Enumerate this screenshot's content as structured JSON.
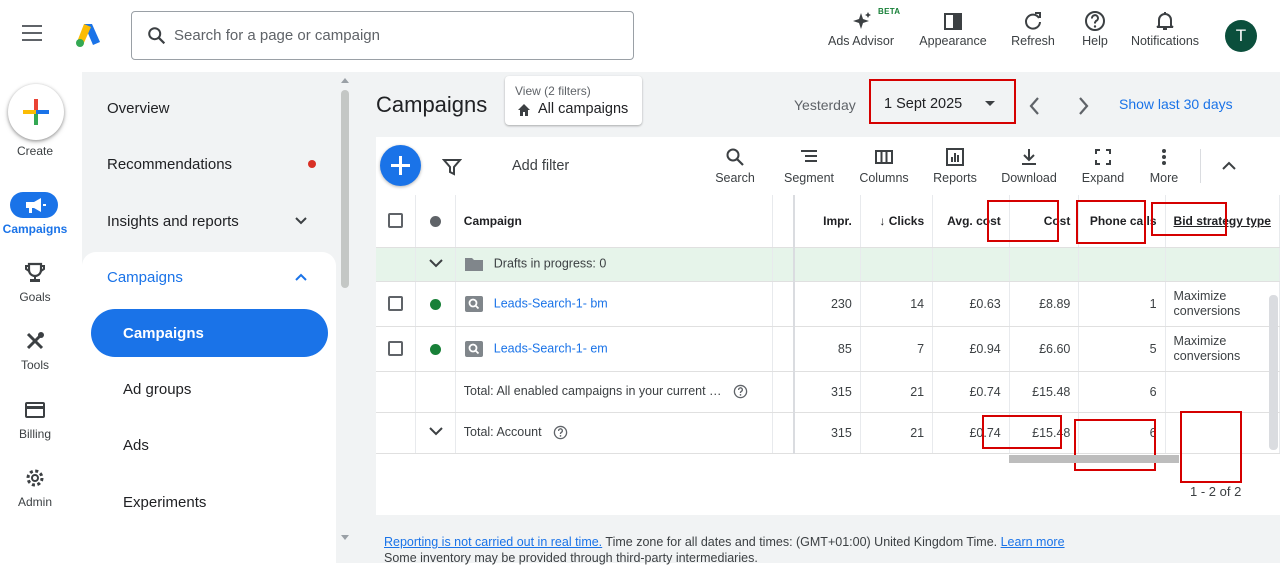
{
  "topbar": {
    "search_placeholder": "Search for a page or campaign",
    "beta": "BETA",
    "tools": [
      {
        "label": "Ads Advisor"
      },
      {
        "label": "Appearance"
      },
      {
        "label": "Refresh"
      },
      {
        "label": "Help"
      },
      {
        "label": "Notifications"
      }
    ],
    "avatar_initial": "T"
  },
  "rail": {
    "create": "Create",
    "items": [
      {
        "label": "Campaigns"
      },
      {
        "label": "Goals"
      },
      {
        "label": "Tools"
      },
      {
        "label": "Billing"
      },
      {
        "label": "Admin"
      }
    ]
  },
  "nav": {
    "overview": "Overview",
    "recommendations": "Recommendations",
    "insights": "Insights and reports",
    "campaigns_section": "Campaigns",
    "sub": [
      {
        "label": "Campaigns"
      },
      {
        "label": "Ad groups"
      },
      {
        "label": "Ads"
      },
      {
        "label": "Experiments"
      }
    ]
  },
  "main": {
    "title": "Campaigns",
    "view_label": "View (2 filters)",
    "view_value": "All campaigns",
    "date_label": "Yesterday",
    "date_value": "1 Sept 2025",
    "show_last": "Show last 30 days"
  },
  "toolbar": {
    "add_filter": "Add filter",
    "buttons": [
      {
        "label": "Search"
      },
      {
        "label": "Segment"
      },
      {
        "label": "Columns"
      },
      {
        "label": "Reports"
      },
      {
        "label": "Download"
      },
      {
        "label": "Expand"
      },
      {
        "label": "More"
      }
    ]
  },
  "table": {
    "headers": {
      "campaign": "Campaign",
      "impr": "Impr.",
      "clicks": "Clicks",
      "avg_cost": "Avg. cost",
      "cost": "Cost",
      "phone_calls": "Phone calls",
      "bid_type": "Bid strategy type"
    },
    "drafts": "Drafts in progress: 0",
    "rows": [
      {
        "name": "Leads-Search-1- bm",
        "impr": "230",
        "clicks": "14",
        "avg_cost": "£0.63",
        "cost": "£8.89",
        "calls": "1",
        "bid": "Maximize conversions"
      },
      {
        "name": "Leads-Search-1- em",
        "impr": "85",
        "clicks": "7",
        "avg_cost": "£0.94",
        "cost": "£6.60",
        "calls": "5",
        "bid": "Maximize conversions"
      }
    ],
    "total_enabled": {
      "label": "Total: All enabled campaigns in your current …",
      "impr": "315",
      "clicks": "21",
      "avg_cost": "£0.74",
      "cost": "£15.48",
      "calls": "6"
    },
    "total_account": {
      "label": "Total: Account",
      "impr": "315",
      "clicks": "21",
      "avg_cost": "£0.74",
      "cost": "£15.48",
      "calls": "6"
    },
    "pager": "1 - 2 of 2"
  },
  "footer": {
    "link1": "Reporting is not carried out in real time.",
    "text1": " Time zone for all dates and times: (GMT+01:00) United Kingdom Time. ",
    "link2": "Learn more",
    "text2": "Some inventory may be provided through third-party intermediaries."
  },
  "colors": {
    "accent": "#1a73e8",
    "status_enabled": "#188038",
    "highlight": "#d50000",
    "draft_row": "#e6f4ea"
  }
}
